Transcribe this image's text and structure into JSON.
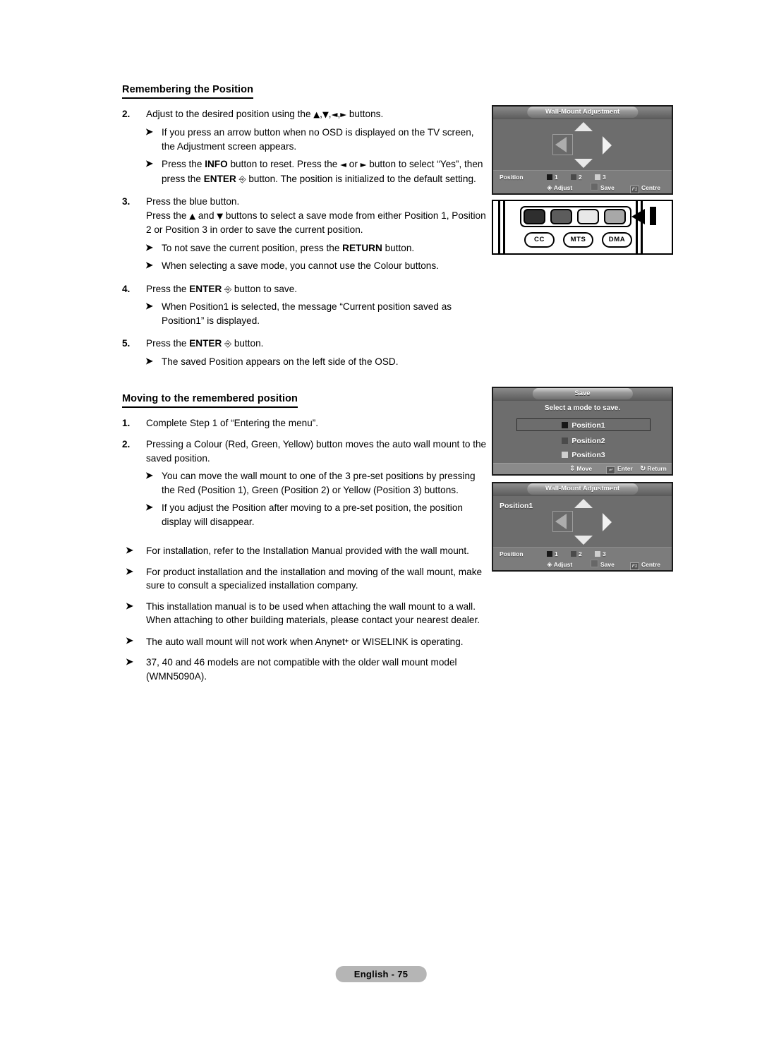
{
  "page": {
    "footer_label": "English - 75"
  },
  "section1": {
    "heading": "Remembering the Position",
    "steps": [
      {
        "num": "2.",
        "text_pre": "Adjust to the desired position using the ",
        "arrows": "▲,▼,◄,►",
        "text_post": " buttons.",
        "bullets": [
          "If you press an arrow button when no OSD is displayed on the TV screen, the Adjustment screen appears.",
          "Press the INFO button to reset. Press the ◄ or ► button to select “Yes”, then press the ENTER ⏎ button. The position is initialized to the default setting."
        ]
      },
      {
        "num": "3.",
        "line1": "Press the blue button.",
        "line2": "Press the ▲ and ▼ buttons to select a save mode from either Position 1, Position 2 or Position 3 in order to save the current position.",
        "bullets": [
          "To not save the current position, press the RETURN button.",
          "When selecting a save mode, you cannot use the Colour buttons."
        ]
      },
      {
        "num": "4.",
        "line1": "Press the ENTER ⏎ button to save.",
        "bullets": [
          "When Position1 is selected, the message “Current position saved as Position1” is displayed."
        ]
      },
      {
        "num": "5.",
        "line1": "Press the ENTER ⏎ button.",
        "bullets": [
          "The saved Position appears on the left side of the OSD."
        ]
      }
    ]
  },
  "section2": {
    "heading": "Moving to the remembered position",
    "steps": [
      {
        "num": "1.",
        "line1": "Complete Step 1 of “Entering the menu”.",
        "bullets": []
      },
      {
        "num": "2.",
        "line1": "Pressing a Colour (Red, Green, Yellow) button moves the auto wall mount to the saved position.",
        "bullets": [
          "You can move the wall mount to one of the 3 pre-set positions by pressing the Red (Position 1), Green (Position 2) or Yellow (Position 3) buttons.",
          "If you adjust the Position after moving to a pre-set position, the position display will disappear."
        ]
      }
    ]
  },
  "notes": [
    "For installation, refer to the Installation Manual provided with the wall mount.",
    "For product installation and the installation and moving of the wall mount, make sure to consult a specialized installation company.",
    "This installation manual is to be used when attaching the wall mount to a wall. When attaching to other building materials, please contact your nearest dealer.",
    "The auto wall mount will not work when Anynet+ or WISELINK is operating.",
    "37, 40 and 46 models are not compatible with the older wall mount model (WMN5090A)."
  ],
  "osd_adjust_top": {
    "title": "Wall-Mount Adjustment",
    "position_label": "",
    "footer": {
      "position_text": "Position",
      "pos1": "1",
      "pos2": "2",
      "pos3": "3",
      "adjust": "Adjust",
      "save": "Save",
      "centre": "Centre",
      "centre_key": "F1"
    }
  },
  "osd_adjust_bottom": {
    "title": "Wall-Mount Adjustment",
    "position_label": "Position1",
    "footer": {
      "position_text": "Position",
      "pos1": "1",
      "pos2": "2",
      "pos3": "3",
      "adjust": "Adjust",
      "save": "Save",
      "centre": "Centre",
      "centre_key": "F1"
    }
  },
  "osd_save": {
    "title": "Save",
    "subtitle": "Select a mode to save.",
    "options": [
      {
        "label": "Position1",
        "selected": true
      },
      {
        "label": "Position2",
        "selected": false
      },
      {
        "label": "Position3",
        "selected": false
      }
    ],
    "footer": {
      "move": "Move",
      "enter": "Enter",
      "return": "Return"
    }
  },
  "remote": {
    "color_buttons": [
      "red",
      "green",
      "yellow",
      "blue"
    ],
    "color_swatches": [
      "#2e2e2e",
      "#5c5c5c",
      "#e8e8e8",
      "#a8a8a8"
    ],
    "keys": [
      "CC",
      "MTS",
      "DMA"
    ]
  },
  "colors": {
    "osd_bg": "#6d6d6d",
    "osd_footer": "#7c7c7c",
    "page_bg": "#ffffff",
    "text": "#000000",
    "footer_pill": "#b5b5b5"
  }
}
